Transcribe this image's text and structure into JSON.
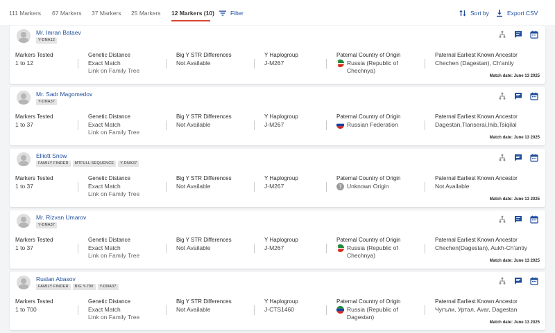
{
  "tabs": [
    {
      "label": "111 Markers",
      "active": false
    },
    {
      "label": "67 Markers",
      "active": false
    },
    {
      "label": "37 Markers",
      "active": false
    },
    {
      "label": "25 Markers",
      "active": false
    },
    {
      "label": "12 Markers (10)",
      "active": true
    }
  ],
  "toolbar": {
    "filter": "Filter",
    "sort": "Sort by",
    "export": "Export CSV"
  },
  "columns": {
    "markers": "Markers Tested",
    "distance": "Genetic Distance",
    "str": "Big Y STR Differences",
    "haplogroup": "Y Haplogroup",
    "country": "Paternal Country of Origin",
    "ancestor": "Paternal Earliest Known Ancestor"
  },
  "link_tree": "Link on Family Tree",
  "accent": "#1f4e9c",
  "tab_underline": "#d8482f",
  "matches": [
    {
      "name": "Mr. Imran Bataev",
      "tags": [
        "Y-DNA12"
      ],
      "markers": "1 to 12",
      "distance": "Exact Match",
      "str": "Not Available",
      "haplogroup": "J-M267",
      "flag": "chechnya",
      "country_line1": "Russia (Republic of",
      "country_line2": "Chechnya)",
      "ancestor": "Chechen (Dagestan), Ch'antiy",
      "match_date": "Match date: June 13 2025"
    },
    {
      "name": "Mr. Sadr Magomedov",
      "tags": [
        "Y-DNA37"
      ],
      "markers": "1 to 37",
      "distance": "Exact Match",
      "str": "Not Available",
      "haplogroup": "J-M267",
      "flag": "russia",
      "country_line1": "Russian Federation",
      "country_line2": "",
      "ancestor": "Dagestan,Tlanserai,Inib,Tsiqilal",
      "match_date": "Match date: June 13 2025"
    },
    {
      "name": "Elliott Snow",
      "tags": [
        "FAMILY FINDER",
        "MTFULL SEQUENCE",
        "Y-DNA37"
      ],
      "markers": "1 to 37",
      "distance": "Exact Match",
      "str": "Not Available",
      "haplogroup": "J-M267",
      "flag": "unknown",
      "country_line1": "Unknown Origin",
      "country_line2": "",
      "ancestor": "Not Available",
      "match_date": "Match date: June 13 2025"
    },
    {
      "name": "Mr. Rizvan Umarov",
      "tags": [
        "Y-DNA37"
      ],
      "markers": "1 to 37",
      "distance": "Exact Match",
      "str": "Not Available",
      "haplogroup": "J-M267",
      "flag": "chechnya",
      "country_line1": "Russia (Republic of",
      "country_line2": "Chechnya)",
      "ancestor": "Chechen(Dagestan), Aukh-Ch'antiy",
      "match_date": "Match date: June 13 2025"
    },
    {
      "name": "Ruslan Abasov",
      "tags": [
        "FAMILY FINDER",
        "BIG Y-700",
        "Y-DNA37"
      ],
      "markers": "1 to 700",
      "distance": "Exact Match",
      "str": "Not Available",
      "haplogroup": "J-CTS1460",
      "flag": "dagestan",
      "country_line1": "Russia (Republic of",
      "country_line2": "Dagestan)",
      "ancestor": "Чугъли, Уртал, Avar, Dagestan",
      "match_date": "Match date: June 13 2025"
    }
  ]
}
